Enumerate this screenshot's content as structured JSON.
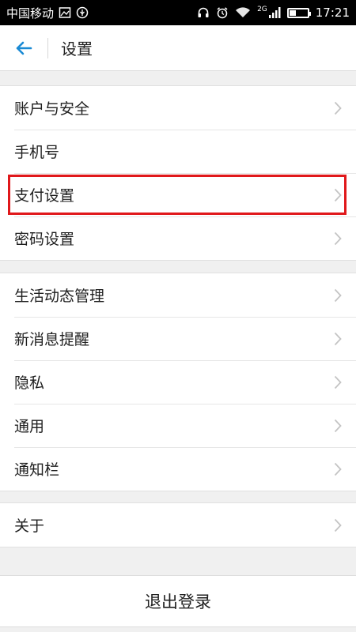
{
  "status_bar": {
    "carrier": "中国移动",
    "time": "17:21",
    "network": "2G",
    "battery_level": 0.35,
    "icons": [
      "image-icon",
      "usb-icon",
      "headset-icon",
      "alarm-icon",
      "wifi-icon",
      "signal-icon",
      "battery-icon"
    ]
  },
  "header": {
    "title": "设置",
    "back_icon": "arrow-left-icon"
  },
  "groups": [
    {
      "items": [
        {
          "label": "账户与安全",
          "chevron": true
        },
        {
          "label": "手机号",
          "chevron": false
        },
        {
          "label": "支付设置",
          "chevron": true
        },
        {
          "label": "密码设置",
          "chevron": true
        }
      ]
    },
    {
      "items": [
        {
          "label": "生活动态管理",
          "chevron": true
        },
        {
          "label": "新消息提醒",
          "chevron": true
        },
        {
          "label": "隐私",
          "chevron": true
        },
        {
          "label": "通用",
          "chevron": true
        },
        {
          "label": "通知栏",
          "chevron": true
        }
      ]
    },
    {
      "items": [
        {
          "label": "关于",
          "chevron": true
        }
      ]
    }
  ],
  "logout": {
    "label": "退出登录"
  },
  "colors": {
    "accent": "#1a8ad4",
    "highlight": "#e0181b",
    "background": "#f0f0f0"
  }
}
